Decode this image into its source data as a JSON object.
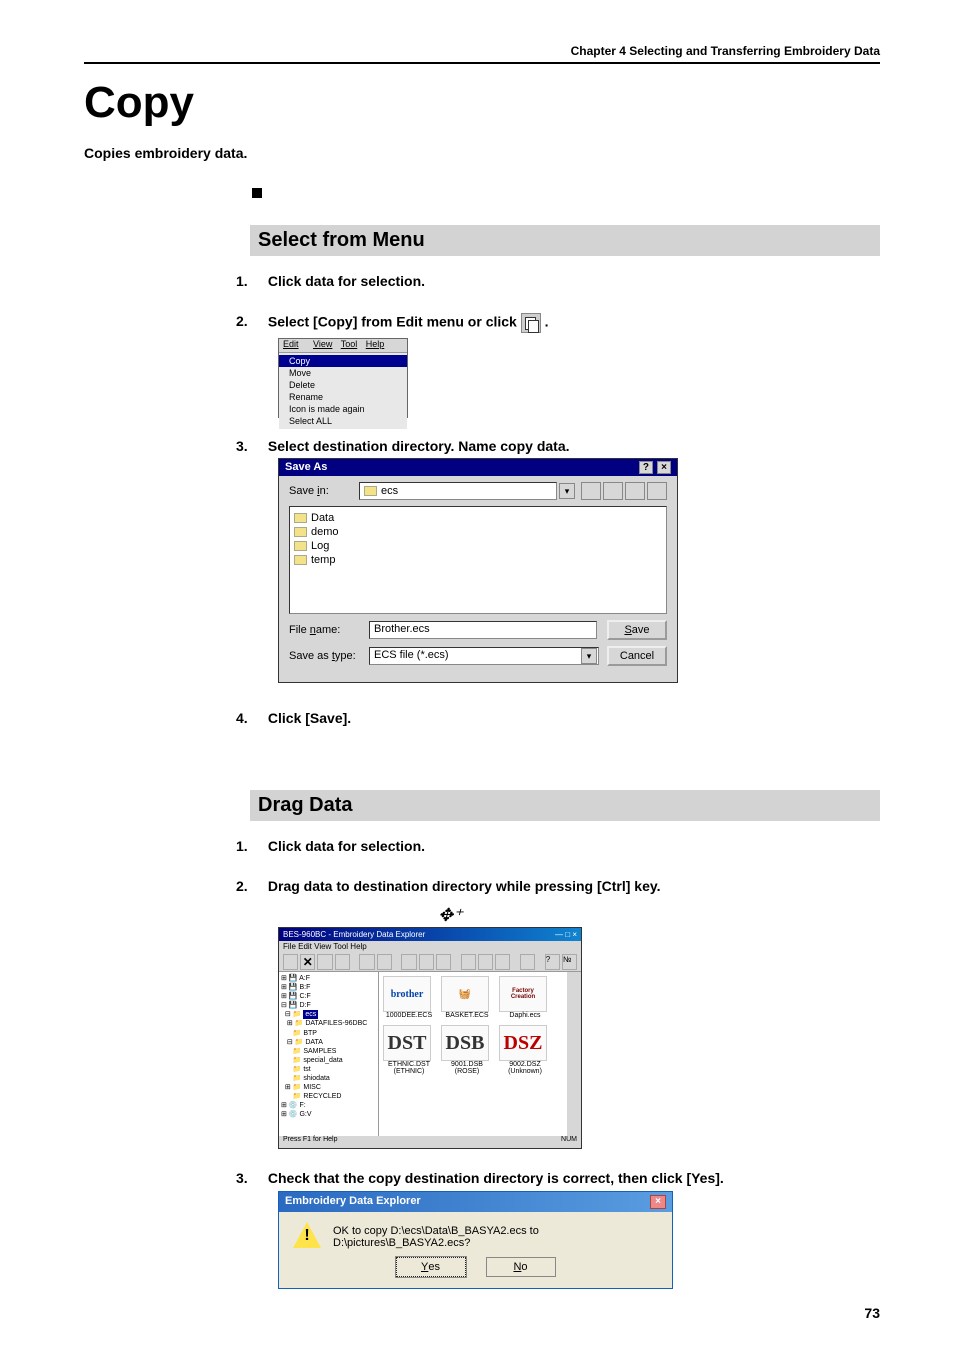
{
  "header_text": "Chapter 4  Selecting and Transferring Embroidery Data",
  "page_number": "73",
  "title": "Copy",
  "subtitle": "Copies embroidery data.",
  "section1": {
    "heading": "Select from Menu",
    "steps": {
      "s1_num": "1.",
      "s1_text": "Click data for selection.",
      "s2_num": "2.",
      "s2_text": "Select [Copy] from Edit menu or click ",
      "s2_after": " .",
      "s3_num": "3.",
      "s3_text": "Select destination directory.  Name copy data.",
      "s4_num": "4.",
      "s4_text": "Click [Save]."
    }
  },
  "edit_menu": {
    "menubar": {
      "m1": "Edit",
      "m2": "View",
      "m3": "Tool",
      "m4": "Help"
    },
    "items": {
      "i0": "Copy",
      "i1": "Move",
      "i2": "Delete",
      "i3": "Rename",
      "i4": "Icon is made again",
      "i5": "Select ALL"
    }
  },
  "saveas": {
    "title": "Save As",
    "savein_label": "Save in:",
    "savein_value": "ecs",
    "folders": {
      "f0": "Data",
      "f1": "demo",
      "f2": "Log",
      "f3": "temp"
    },
    "filename_label": "File name:",
    "filename_value": "Brother.ecs",
    "saveastype_label": "Save as type:",
    "saveastype_value": "ECS file (*.ecs)",
    "save_btn": "Save",
    "cancel_btn": "Cancel"
  },
  "section2": {
    "heading": "Drag Data",
    "steps": {
      "s1_num": "1.",
      "s1_text": "Click data for selection.",
      "s2_num": "2.",
      "s2_text": "Drag data to destination directory while pressing [Ctrl] key.",
      "s3_num": "3.",
      "s3_text": "Check that the copy destination directory is correct, then click [Yes]."
    }
  },
  "explorer": {
    "title": "BES-960BC - Embroidery Data Explorer",
    "menubar": "File  Edit  View  Tool  Help",
    "tree": {
      "t0": "A:F",
      "t1": "B:F",
      "t2": "C:F",
      "t3": "D:F",
      "t4_sel": "ecs",
      "t5": "DATAFILES-96DBC",
      "t6": "BTP",
      "t7": "DATA",
      "t8": "SAMPLES",
      "t9": "special_data",
      "t10": "tst",
      "t11": "shiodata",
      "t12": "MISC",
      "t13": "RECYCLED",
      "t14": "F:",
      "t15": "G:V"
    },
    "files": {
      "f0_name": "1000DEE.ECS",
      "f0_thumb": "brother",
      "f1_name": "BASKET.ECS",
      "f1_thumb": "🧺",
      "f2_name": "Daphi.ecs",
      "f2_thumb": "Factory Creation",
      "f3_name": "ETHNIC.DST",
      "f3_thumb": "DST",
      "f3_sub": "(ETHNIC)",
      "f4_name": "9001.DSB",
      "f4_thumb": "DSB",
      "f4_sub": "(ROSE)",
      "f5_name": "9002.DSZ",
      "f5_thumb": "DSZ",
      "f5_sub": "(Unknown)"
    },
    "status_left": "Press F1 for Help",
    "status_right": "NUM"
  },
  "confirm": {
    "title": "Embroidery Data Explorer",
    "message": "OK to copy D:\\ecs\\Data\\B_BASYA2.ecs to D:\\pictures\\B_BASYA2.ecs?",
    "yes": "Yes",
    "no": "No"
  }
}
